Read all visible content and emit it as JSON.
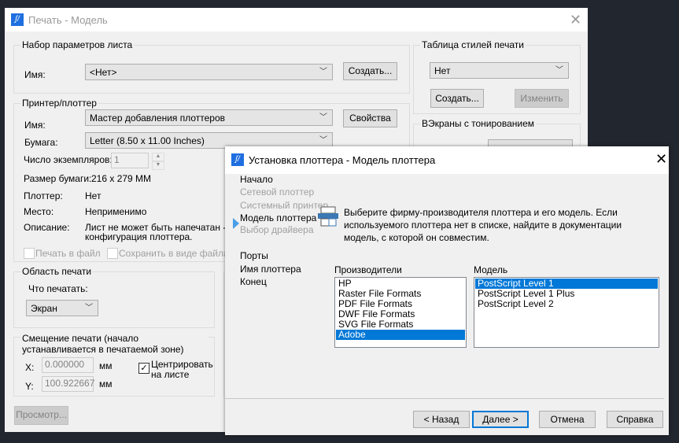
{
  "print_dialog": {
    "title": "Печать - Модель",
    "page_setup": {
      "group": "Набор параметров листа",
      "name_label": "Имя:",
      "name_value": "<Нет>",
      "create_button": "Создать..."
    },
    "printer": {
      "group": "Принтер/плоттер",
      "name_label": "Имя:",
      "name_value": "Мастер добавления плоттеров",
      "properties_button": "Свойства",
      "paper_label": "Бумага:",
      "paper_value": "Letter (8.50 x 11.00 Inches)",
      "copies_label": "Число экземпляров:",
      "copies_value": "1",
      "paper_size_label": "Размер бумаги:",
      "paper_size_value": "216 x 279  MM",
      "plotter_label": "Плоттер:",
      "plotter_value": "Нет",
      "location_label": "Место:",
      "location_value": "Неприменимо",
      "description_label": "Описание:",
      "description_line1": "Лист не может быть напечатан - не",
      "description_line2": "конфигурация плоттера.",
      "print_to_file": "Печать в файл",
      "save_as_file": "Сохранить в виде файла че"
    },
    "plot_area": {
      "group": "Область печати",
      "what_label": "Что печатать:",
      "what_value": "Экран"
    },
    "plot_offset": {
      "group": "Смещение печати (начало устанавливается в печатаемой зоне)",
      "x_label": "X:",
      "x_value": "0.000000",
      "y_label": "Y:",
      "y_value": "100.922667",
      "unit": "мм",
      "center_label_1": "Центрировать",
      "center_label_2": "на листе",
      "center_checked": true
    },
    "preview_button": "Просмотр...",
    "style_table": {
      "group": "Таблица стилей печати",
      "value": "Нет",
      "create_button": "Создать...",
      "edit_button": "Изменить"
    },
    "shaded_viewports": {
      "group": "ВЭкраны с тонированием"
    }
  },
  "wizard": {
    "title": "Установка плоттера - Модель плоттера",
    "steps": [
      {
        "label": "Начало",
        "enabled": true
      },
      {
        "label": "Сетевой плоттер",
        "enabled": false
      },
      {
        "label": "Системный принтер",
        "enabled": false
      },
      {
        "label": "Модель плоттера",
        "enabled": true,
        "current": true
      },
      {
        "label": "Выбор драйвера",
        "enabled": false
      },
      {
        "label": "Порты",
        "enabled": true
      },
      {
        "label": "Имя плоттера",
        "enabled": true
      },
      {
        "label": "Конец",
        "enabled": true
      }
    ],
    "instruction": "Выберите фирму-производителя плоттера и его модель. Если используемого плоттера нет в списке, найдите в документации модель, с которой он совместим.",
    "manufacturers_label": "Производители",
    "manufacturers": [
      "HP",
      "Raster File Formats",
      "PDF File Formats",
      "DWF File Formats",
      "SVG File Formats",
      "Adobe"
    ],
    "manufacturer_selected": "Adobe",
    "model_label": "Модель",
    "models": [
      "PostScript Level 1",
      "PostScript Level 1 Plus",
      "PostScript Level 2"
    ],
    "model_selected": "PostScript Level 1",
    "back_button": "< Назад",
    "next_button": "Далее >",
    "cancel_button": "Отмена",
    "help_button": "Справка"
  },
  "colors": {
    "selection": "#0078d7",
    "backdrop": "#22262e",
    "dialog": "#f0f0f0"
  }
}
